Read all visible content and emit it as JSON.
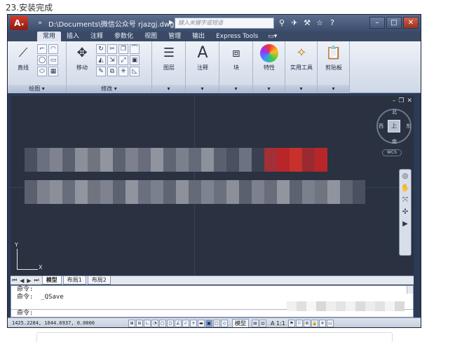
{
  "caption": "23.安装完成",
  "titlebar": {
    "logo": "A",
    "document_path": "D:\\Documents\\微信公众号   rjazgj.dwg",
    "search_placeholder": "键入关键字或短语",
    "icons": [
      "binoculars-icon",
      "satellite-icon",
      "exchange-icon",
      "star-icon",
      "help-icon"
    ],
    "help_label": "?"
  },
  "ribbon_tabs": [
    "常用",
    "插入",
    "注释",
    "参数化",
    "视图",
    "管理",
    "输出",
    "Express Tools"
  ],
  "active_tab": "常用",
  "panels": {
    "draw": {
      "title": "绘图",
      "line_label": "直线"
    },
    "modify": {
      "title": "修改",
      "move_label": "移动"
    },
    "layers": {
      "title": "图层"
    },
    "annotation": {
      "title": "注释"
    },
    "block": {
      "title": "块"
    },
    "properties": {
      "title": "特性"
    },
    "utilities": {
      "title": "实用工具"
    },
    "clipboard": {
      "title": "剪贴板"
    }
  },
  "viewcube": {
    "north": "北",
    "south": "南",
    "west": "西",
    "east": "东",
    "top_label": "上",
    "wcs": "WCS"
  },
  "ucs": {
    "x": "X",
    "y": "Y"
  },
  "layout_tabs": [
    "模型",
    "布局1",
    "布局2"
  ],
  "active_layout": "模型",
  "command_lines": [
    "命令:",
    "命令:  _QSave"
  ],
  "command_prompt": "命令:",
  "statusbar": {
    "coords": "1425.2284, 1644.6937, 0.0000",
    "model": "模型",
    "scale": "A 1:1"
  },
  "colors": {
    "canvas": "#2a3140",
    "titlebar": "#46587a",
    "ribbon": "#dfe6f1",
    "blur_red": "#b8262a"
  }
}
